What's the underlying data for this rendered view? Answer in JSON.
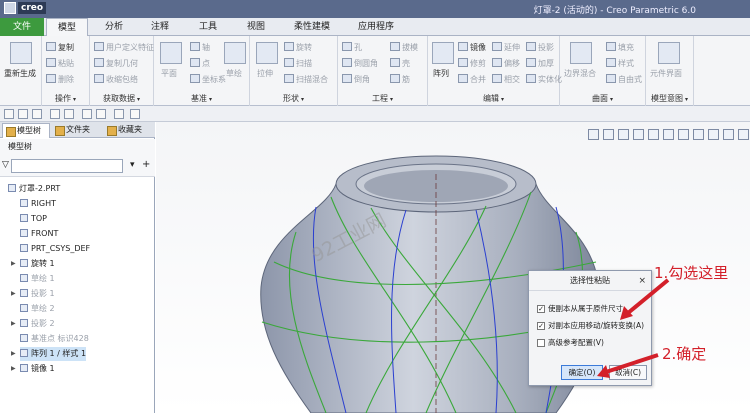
{
  "window": {
    "logo_text": "creo",
    "title": "灯罩-2 (活动的) - Creo Parametric 6.0"
  },
  "tabs": [
    {
      "label": "文件"
    },
    {
      "label": "模型"
    },
    {
      "label": "分析"
    },
    {
      "label": "注释"
    },
    {
      "label": "工具"
    },
    {
      "label": "视图"
    },
    {
      "label": "柔性建模"
    },
    {
      "label": "应用程序"
    }
  ],
  "ribbon": {
    "regen": {
      "label": "重新生成"
    },
    "ops": {
      "label": "操作",
      "copy": "复制",
      "paste": "粘贴",
      "delete": "删除"
    },
    "getdata": {
      "label": "获取数据",
      "udf": "用户定义特征",
      "copygeom": "复制几何",
      "shrink": "收缩包络"
    },
    "datum": {
      "label": "基准",
      "plane": "平面",
      "axis": "轴",
      "point": "点",
      "csys": "坐标系",
      "sketch": "草绘"
    },
    "shapes": {
      "label": "形状",
      "extrude": "拉伸",
      "revolve": "旋转",
      "sweep": "扫描",
      "helical": "扫描混合"
    },
    "eng": {
      "label": "工程",
      "hole": "孔",
      "round": "倒圆角",
      "chamfer": "倒角",
      "draft": "拔模",
      "shell": "壳",
      "rib": "筋"
    },
    "edit": {
      "label": "编辑",
      "pattern": "阵列",
      "mirror": "镜像",
      "trim": "修剪",
      "merge": "合并",
      "extend": "延伸",
      "offset": "偏移",
      "intersect": "相交",
      "project": "投影",
      "thicken": "加厚",
      "solidify": "实体化"
    },
    "surface": {
      "label": "曲面",
      "boundary": "边界混合",
      "fill": "填充",
      "style": "样式",
      "freestyle": "自由式"
    },
    "modelintent": {
      "label": "模型意图",
      "component": "元件界面"
    }
  },
  "panel": {
    "tabs": [
      {
        "label": "模型树"
      },
      {
        "label": "文件夹"
      },
      {
        "label": "收藏夹"
      }
    ],
    "header": "模型树",
    "search_placeholder": "",
    "tree": [
      {
        "label": "灯罩-2.PRT",
        "dim": false,
        "selected": false,
        "expander": ""
      },
      {
        "label": "RIGHT",
        "dim": false,
        "selected": false,
        "expander": ""
      },
      {
        "label": "TOP",
        "dim": false,
        "selected": false,
        "expander": ""
      },
      {
        "label": "FRONT",
        "dim": false,
        "selected": false,
        "expander": ""
      },
      {
        "label": "PRT_CSYS_DEF",
        "dim": false,
        "selected": false,
        "expander": ""
      },
      {
        "label": "旋转 1",
        "dim": false,
        "selected": false,
        "expander": "▶"
      },
      {
        "label": "草绘 1",
        "dim": true,
        "selected": false,
        "expander": ""
      },
      {
        "label": "投影 1",
        "dim": true,
        "selected": false,
        "expander": "▶"
      },
      {
        "label": "草绘 2",
        "dim": true,
        "selected": false,
        "expander": ""
      },
      {
        "label": "投影 2",
        "dim": true,
        "selected": false,
        "expander": "▶"
      },
      {
        "label": "基准点 标识428",
        "dim": true,
        "selected": false,
        "expander": ""
      },
      {
        "label": "阵列 1 / 样式 1",
        "dim": false,
        "selected": true,
        "expander": "▶"
      },
      {
        "label": "镜像 1",
        "dim": false,
        "selected": false,
        "expander": "▶"
      }
    ]
  },
  "watermark": "92工业网",
  "dialog": {
    "title": "选择性粘贴",
    "close": "×",
    "options": [
      {
        "label": "使副本从属于原件尺寸",
        "checked": true
      },
      {
        "label": "对副本应用移动/旋转变换(A)",
        "checked": true
      },
      {
        "label": "高级参考配置(V)",
        "checked": false
      }
    ],
    "ok": "确定(O)",
    "cancel": "取消(C)"
  },
  "annotations": {
    "step1": "1.勾选这里",
    "step2": "2.确定"
  }
}
